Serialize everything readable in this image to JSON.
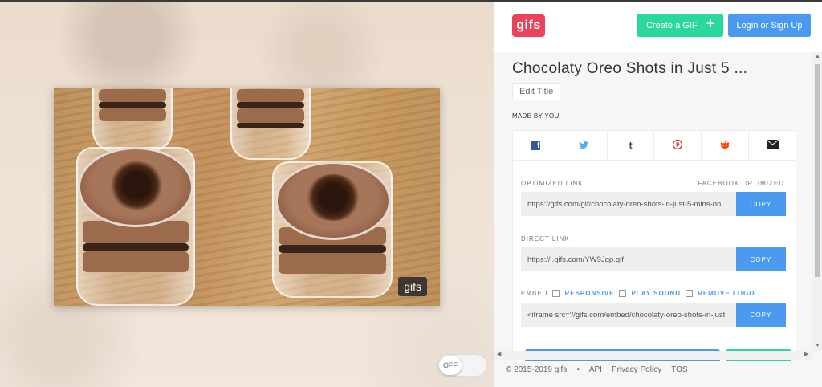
{
  "header": {
    "logo_text": "gifs",
    "create_label": "Create a GIF",
    "create_icon": "+",
    "login_label": "Login or Sign Up"
  },
  "gif": {
    "badge": "gifs"
  },
  "toggle": {
    "label": "OFF"
  },
  "details": {
    "title": "Chocolaty Oreo Shots in Just 5 ...",
    "edit_title_label": "Edit Title",
    "made_by": "MADE BY YOU"
  },
  "share": [
    {
      "name": "facebook-icon",
      "glyph": "f",
      "color": "#3b5998"
    },
    {
      "name": "twitter-icon",
      "glyph": "🐦",
      "color": "#55acee"
    },
    {
      "name": "tumblr-icon",
      "glyph": "t",
      "color": "#35465c"
    },
    {
      "name": "pinterest-icon",
      "glyph": "℗",
      "color": "#cb2027"
    },
    {
      "name": "reddit-icon",
      "glyph": "◉",
      "color": "#ff4500"
    },
    {
      "name": "email-icon",
      "glyph": "✉",
      "color": "#222222"
    }
  ],
  "links": {
    "optimized_label": "OPTIMIZED LINK",
    "optimized_tag": "FACEBOOK OPTIMIZED",
    "optimized_value": "https://gifs.com/gif/chocolaty-oreo-shots-in-just-5-mins-on",
    "direct_label": "DIRECT LINK",
    "direct_value": "https://j.gifs.com/YW9Jgp.gif",
    "embed_label": "EMBED",
    "embed_options": [
      "RESPONSIVE",
      "PLAY SOUND",
      "REMOVE LOGO"
    ],
    "embed_value": "<iframe src='//gifs.com/embed/chocolaty-oreo-shots-in-just",
    "copy_label": "COPY"
  },
  "footer": {
    "copyright": "© 2015-2019 gifs",
    "separator": "•",
    "api": "API",
    "privacy": "Privacy Policy",
    "tos": "TOS"
  },
  "colors": {
    "brand": "#e9445a",
    "green": "#2ad79c",
    "blue": "#4a9bef"
  }
}
